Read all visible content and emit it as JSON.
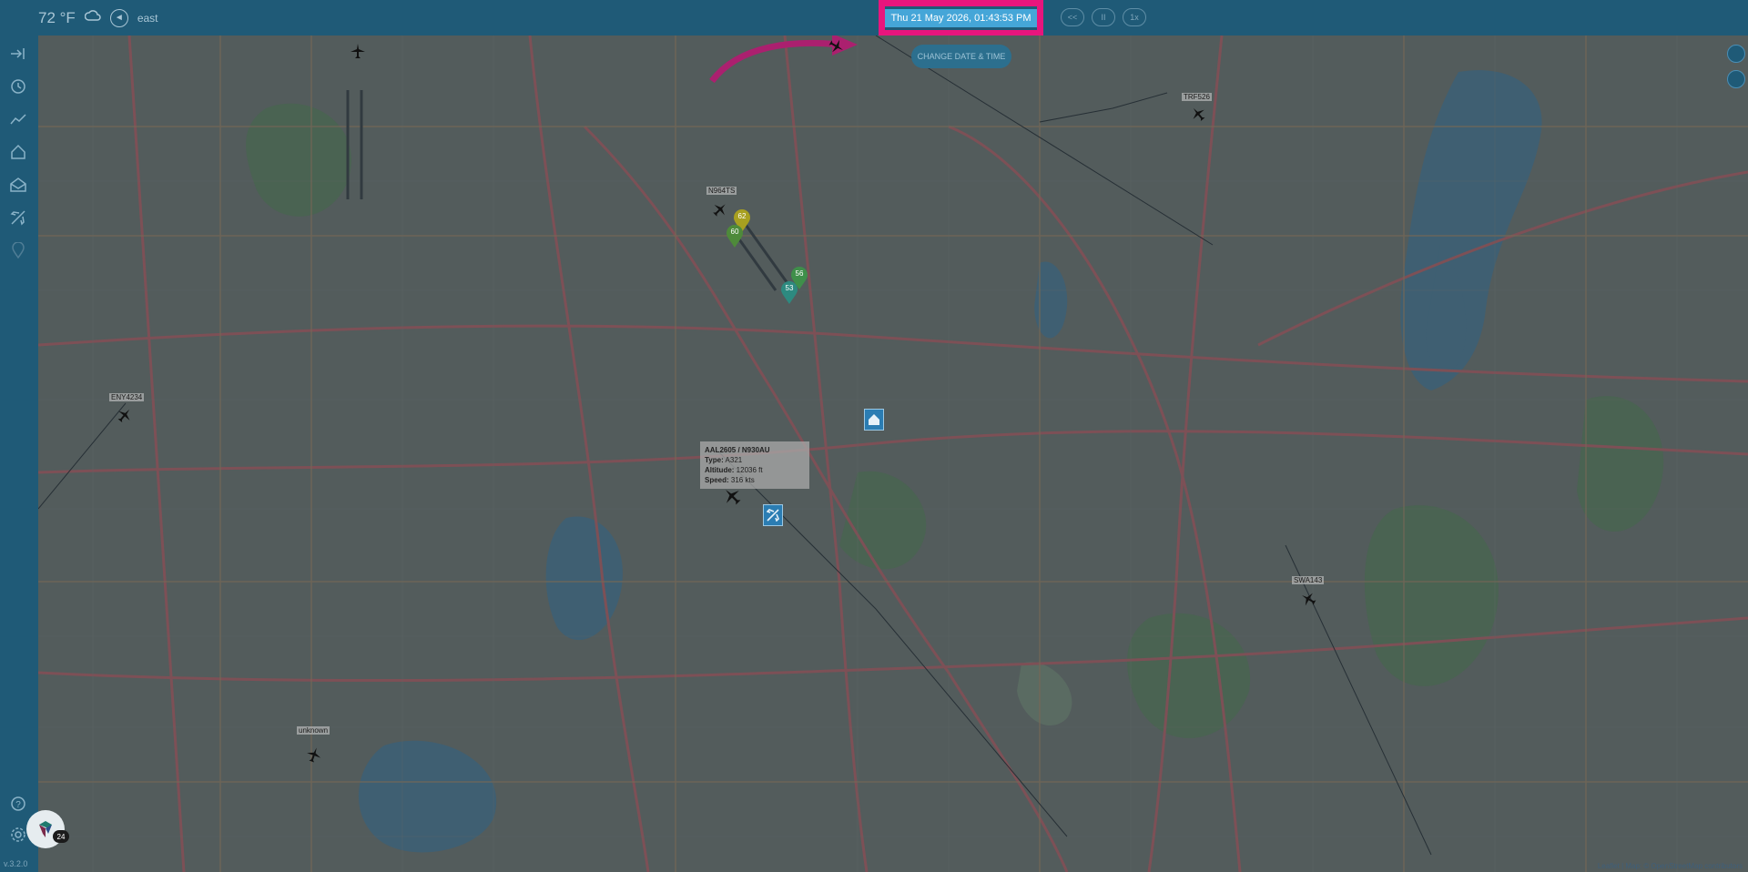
{
  "weather": {
    "temperature": "72 °F",
    "wind_direction": "east",
    "icons": [
      "cloud-icon",
      "wind-direction-icon",
      "wind-arrow-icon"
    ]
  },
  "datetime": "Thu 21 May 2026, 01:43:53 PM",
  "playback": {
    "rewind": "<<",
    "pause": "II",
    "speed": "1x"
  },
  "change_datetime_button": "CHANGE DATE & TIME",
  "sidebar": {
    "icons": [
      "expand-icon",
      "history-clock-icon",
      "chart-icon",
      "home-icon",
      "inbox-icon",
      "airplane-icon",
      "location-pin-icon",
      "help-icon",
      "settings-icon"
    ],
    "version": "v.3.2.0"
  },
  "aircraft": [
    {
      "label": "N964TS"
    },
    {
      "label": "TRF526"
    },
    {
      "label": "ENY4234"
    },
    {
      "label": "SWA143"
    },
    {
      "label": "unknown"
    }
  ],
  "tooltip": {
    "title": "AAL2605 / N930AU",
    "type_label": "Type:",
    "type": "A321",
    "altitude_label": "Altitude:",
    "altitude": "12036 ft",
    "speed_label": "Speed:",
    "speed": "316 kts"
  },
  "pins": [
    {
      "number": "62",
      "color": "#a8a020"
    },
    {
      "number": "60",
      "color": "#4e8a3a"
    },
    {
      "number": "56",
      "color": "#3f8f4a"
    },
    {
      "number": "53",
      "color": "#2d8a80"
    }
  ],
  "notifications_count": "24",
  "attribution": {
    "leaflet": "Leaflet",
    "separator": " | Map: © ",
    "osm": "OpenStreetMap contributors"
  },
  "colors": {
    "topbar": "#1f5a77",
    "highlight": "#e8157d",
    "datetime_bg": "#45a6d8",
    "map_overlay": "rgba(30,60,80,0.30)"
  }
}
